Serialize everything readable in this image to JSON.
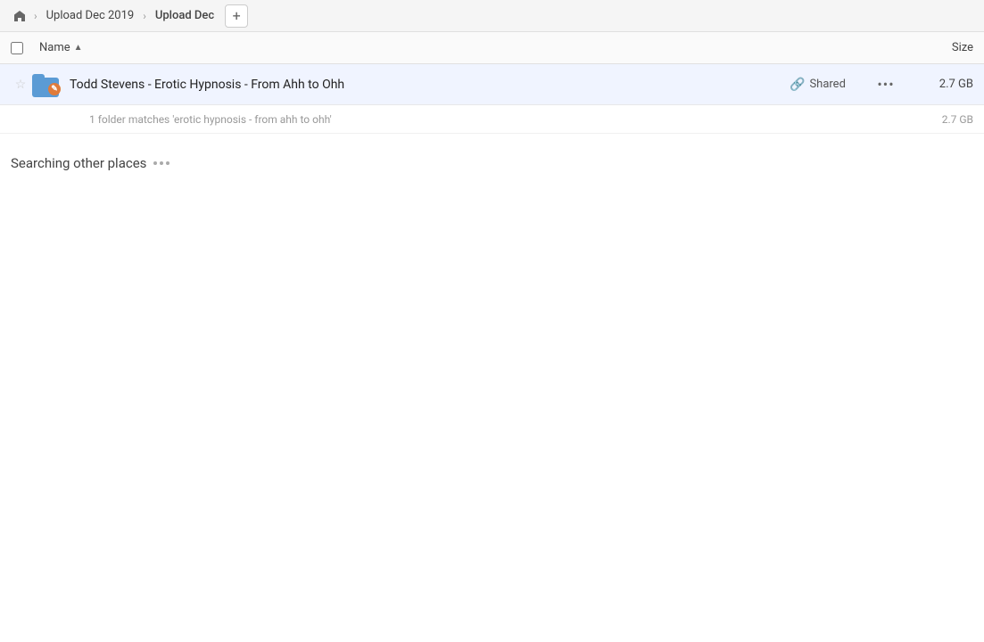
{
  "breadcrumb": {
    "home_icon": "🏠",
    "items": [
      {
        "label": "Upload Dec 2019",
        "active": false
      },
      {
        "label": "Upload Dec",
        "active": true
      }
    ],
    "add_tab_label": "+"
  },
  "column_headers": {
    "name_label": "Name",
    "sort_arrow": "▲",
    "size_label": "Size"
  },
  "file_row": {
    "name": "Todd Stevens - Erotic Hypnosis - From Ahh to Ohh",
    "shared_label": "Shared",
    "size": "2.7 GB"
  },
  "match_info": {
    "text": "1 folder matches 'erotic hypnosis - from ahh to ohh'",
    "size": "2.7 GB"
  },
  "searching": {
    "label": "Searching other places"
  }
}
